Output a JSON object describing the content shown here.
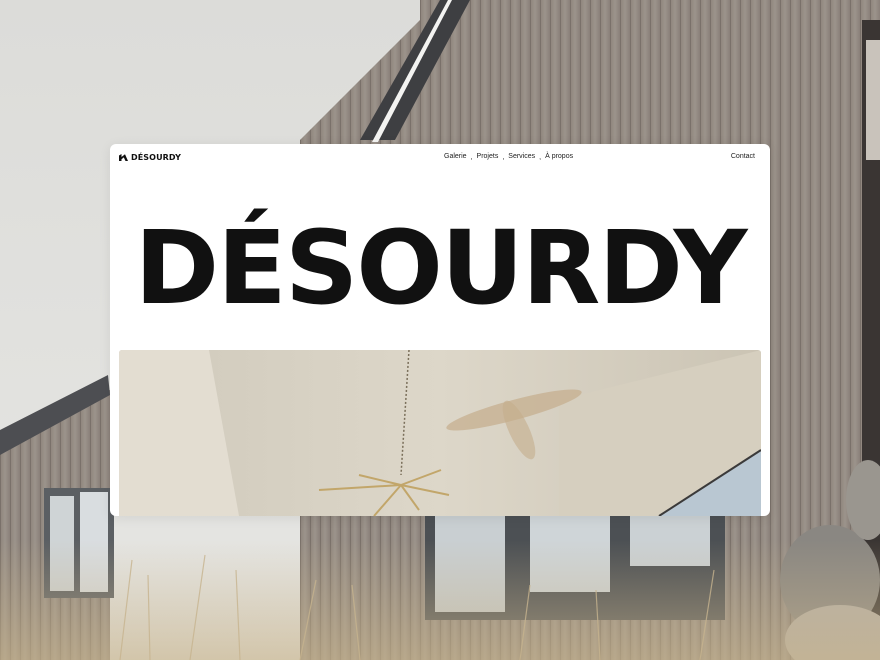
{
  "site": {
    "logo_text": "DÉSOURDY",
    "nav": {
      "items": [
        {
          "label": "Galerie"
        },
        {
          "label": "Projets"
        },
        {
          "label": "Services"
        },
        {
          "label": "À propos"
        }
      ],
      "separator": ",",
      "contact_label": "Contact"
    },
    "hero": {
      "title": "DÉSOURDY"
    }
  },
  "colors": {
    "text": "#111111",
    "card_bg": "#ffffff"
  },
  "icons": {
    "logo_mark": "desourdy-logo-icon"
  }
}
